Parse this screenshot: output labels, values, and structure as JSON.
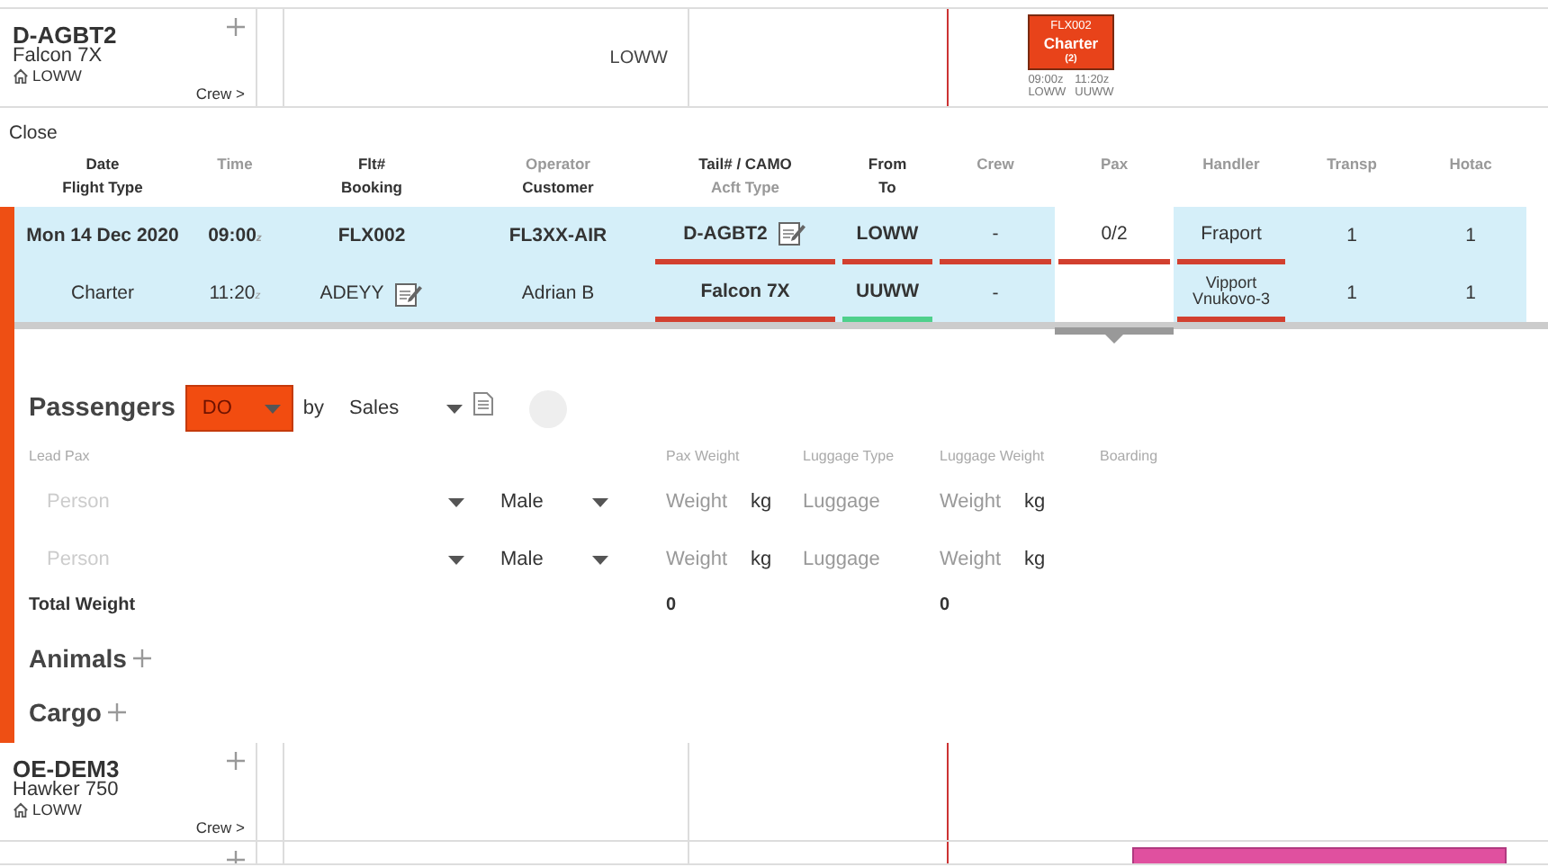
{
  "aircraft": [
    {
      "registration": "D-AGBT2",
      "type": "Falcon 7X",
      "base": "LOWW",
      "crew_link": "Crew >",
      "timeline_label": "LOWW",
      "flights": [
        {
          "number": "FLX002",
          "type": "Charter",
          "count": "(2)",
          "departure_time": "09:00z",
          "arrival_time": "11:20z",
          "from": "LOWW",
          "to": "UUWW",
          "color": "#e8431a"
        }
      ]
    }
  ],
  "close": "Close",
  "columns": [
    {
      "top": {
        "text": "Date",
        "muted": false
      },
      "bottom": {
        "text": "Flight Type",
        "muted": false
      }
    },
    {
      "top": {
        "text": "Time",
        "muted": true
      }
    },
    {
      "top": {
        "text": "Flt#",
        "muted": false
      },
      "bottom": {
        "text": "Booking",
        "muted": false
      }
    },
    {
      "top": {
        "text": "Operator",
        "muted": true
      },
      "bottom": {
        "text": "Customer",
        "muted": false
      }
    },
    {
      "top": {
        "text": "Tail# / CAMO",
        "muted": false
      },
      "bottom": {
        "text": "Acft Type",
        "muted": true
      }
    },
    {
      "top": {
        "text": "From",
        "muted": false
      },
      "bottom": {
        "text": "To",
        "muted": false
      }
    },
    {
      "top": {
        "text": "Crew",
        "muted": true
      }
    },
    {
      "top": {
        "text": "Pax",
        "muted": true
      }
    },
    {
      "top": {
        "text": "Handler",
        "muted": true
      }
    },
    {
      "top": {
        "text": "Transp",
        "muted": true
      }
    },
    {
      "top": {
        "text": "Hotac",
        "muted": true
      }
    }
  ],
  "rows": [
    {
      "cells": [
        {
          "text": "Mon 14 Dec 2020",
          "bold": true,
          "shaded": true
        },
        {
          "text": "09:00$_{z}$",
          "bold": true,
          "shaded": true
        },
        {
          "text": "FLX002",
          "bold": true,
          "shaded": true
        },
        {
          "text": "FL3XX-AIR",
          "bold": true,
          "shaded": true
        },
        {
          "text": "D-AGBT2",
          "bold": true,
          "shaded": true,
          "edit": true,
          "color": "#d2402f"
        },
        {
          "text": "LOWW",
          "bold": true,
          "shaded": true,
          "color": "#d2402f"
        },
        {
          "text": "-",
          "bold": false,
          "shaded": true,
          "color": "#d2402f"
        },
        {
          "text": "0/2",
          "bold": false,
          "shaded": false,
          "color": "#d2402f"
        },
        {
          "text": "Fraport",
          "bold": false,
          "shaded": true,
          "color": "#d2402f"
        },
        {
          "text": "1",
          "bold": false,
          "shaded": true
        },
        {
          "text": "1",
          "bold": false,
          "shaded": true
        }
      ]
    },
    {
      "cells": [
        {
          "text": "Charter",
          "bold": false,
          "shaded": true
        },
        {
          "text": "11:20$_{z}$",
          "bold": false,
          "shaded": true
        },
        {
          "text": "ADEYY",
          "bold": false,
          "shaded": true,
          "edit": true
        },
        {
          "text": "Adrian B",
          "bold": false,
          "shaded": true
        },
        {
          "text": "Falcon 7X",
          "bold": true,
          "shaded": true,
          "color": "#d2402f"
        },
        {
          "text": "UUWW",
          "bold": true,
          "shaded": true,
          "color": "#4fd08c"
        },
        {
          "text": "-",
          "bold": false,
          "shaded": true
        },
        {
          "shaded": false
        },
        {
          "text": "Vipport Vnukovo-3",
          "bold": false,
          "shaded": true,
          "small": true,
          "color": "#d2402f"
        },
        {
          "text": "1",
          "bold": false,
          "shaded": true
        },
        {
          "text": "1",
          "bold": false,
          "shaded": true
        }
      ]
    }
  ],
  "passengers": {
    "title": "Passengers",
    "status": "DO",
    "by": "by",
    "assigned": "Sales",
    "columns": [
      "Lead Pax",
      "Pax Weight",
      "Luggage Type",
      "Luggage Weight",
      "Boarding"
    ],
    "rows": [
      {
        "name_placeholder": "Person",
        "gender": "Male",
        "weight_placeholder": "Weight",
        "weight_unit": "kg",
        "luggage_placeholder": "Luggage",
        "luggage_weight_placeholder": "Weight",
        "luggage_unit": "kg"
      },
      {
        "name_placeholder": "Person",
        "gender": "Male",
        "weight_placeholder": "Weight",
        "weight_unit": "kg",
        "luggage_placeholder": "Luggage",
        "luggage_weight_placeholder": "Weight",
        "luggage_unit": "kg"
      }
    ],
    "total": {
      "label": "Total Weight",
      "pax_weight": "0",
      "luggage_weight": "0"
    }
  },
  "sections": [
    {
      "title": "Animals"
    },
    {
      "title": "Cargo"
    }
  ],
  "aircraft_below": [
    {
      "registration": "OE-DEM3",
      "type": "Hawker 750",
      "base": "LOWW",
      "crew_link": "Crew >"
    },
    {
      "flights": [
        {
          "color": "#e0509f"
        }
      ]
    }
  ]
}
